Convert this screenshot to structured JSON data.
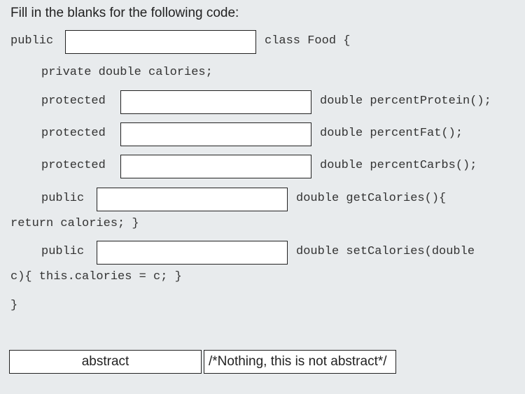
{
  "instruction": "Fill in the blanks for the following code:",
  "code": {
    "line1_prefix": "public",
    "line1_suffix": "class Food {",
    "line2": "private double calories;",
    "line3_prefix": "protected",
    "line3_suffix": "double percentProtein();",
    "line4_prefix": "protected",
    "line4_suffix": "double percentFat();",
    "line5_prefix": "protected",
    "line5_suffix": "double percentCarbs();",
    "line6_prefix": "public",
    "line6_suffix": "double getCalories(){",
    "line7": "return calories; }",
    "line8_prefix": "public",
    "line8_suffix": "double setCalories(double",
    "line9": "c){ this.calories = c; }",
    "line10": "}"
  },
  "blanks": [
    "",
    "",
    "",
    "",
    "",
    ""
  ],
  "answer_choices": [
    "abstract",
    "/*Nothing, this is not abstract*/"
  ]
}
